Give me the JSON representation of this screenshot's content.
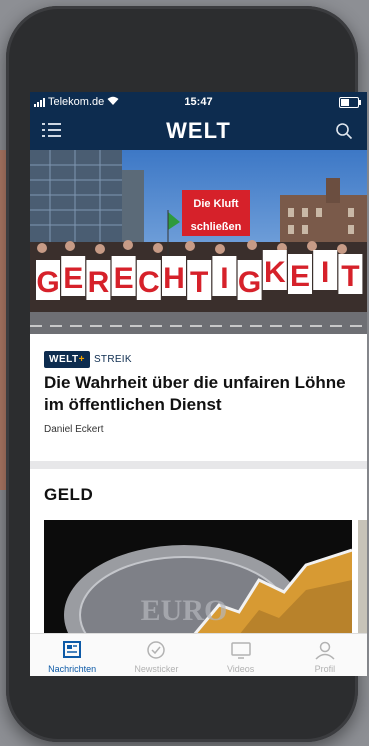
{
  "status_bar": {
    "carrier": "Telekom.de",
    "time": "15:47"
  },
  "header": {
    "logo": "WELT"
  },
  "hero": {
    "sign_text_line1": "Die Kluft",
    "sign_text_line2": "schließen",
    "banner_letters": [
      "G",
      "E",
      "R",
      "E",
      "C",
      "H",
      "T",
      "I",
      "G",
      "K",
      "E",
      "I",
      "T"
    ]
  },
  "article": {
    "badge_main": "WELT",
    "badge_plus": "+",
    "kicker": "STREIK",
    "headline": "Die Wahrheit über die unfairen Löhne im öffentlichen Dienst",
    "author": "Daniel Eckert"
  },
  "section": {
    "title": "GELD"
  },
  "tabs": [
    {
      "label": "Nachrichten",
      "icon": "newspaper-icon",
      "active": true
    },
    {
      "label": "Newsticker",
      "icon": "clock-icon",
      "active": false
    },
    {
      "label": "Videos",
      "icon": "monitor-icon",
      "active": false
    },
    {
      "label": "Profil",
      "icon": "person-icon",
      "active": false
    }
  ],
  "colors": {
    "brand_navy": "#0d2c4f",
    "active_tab": "#0d5aa7",
    "accent": "#f4a300"
  }
}
